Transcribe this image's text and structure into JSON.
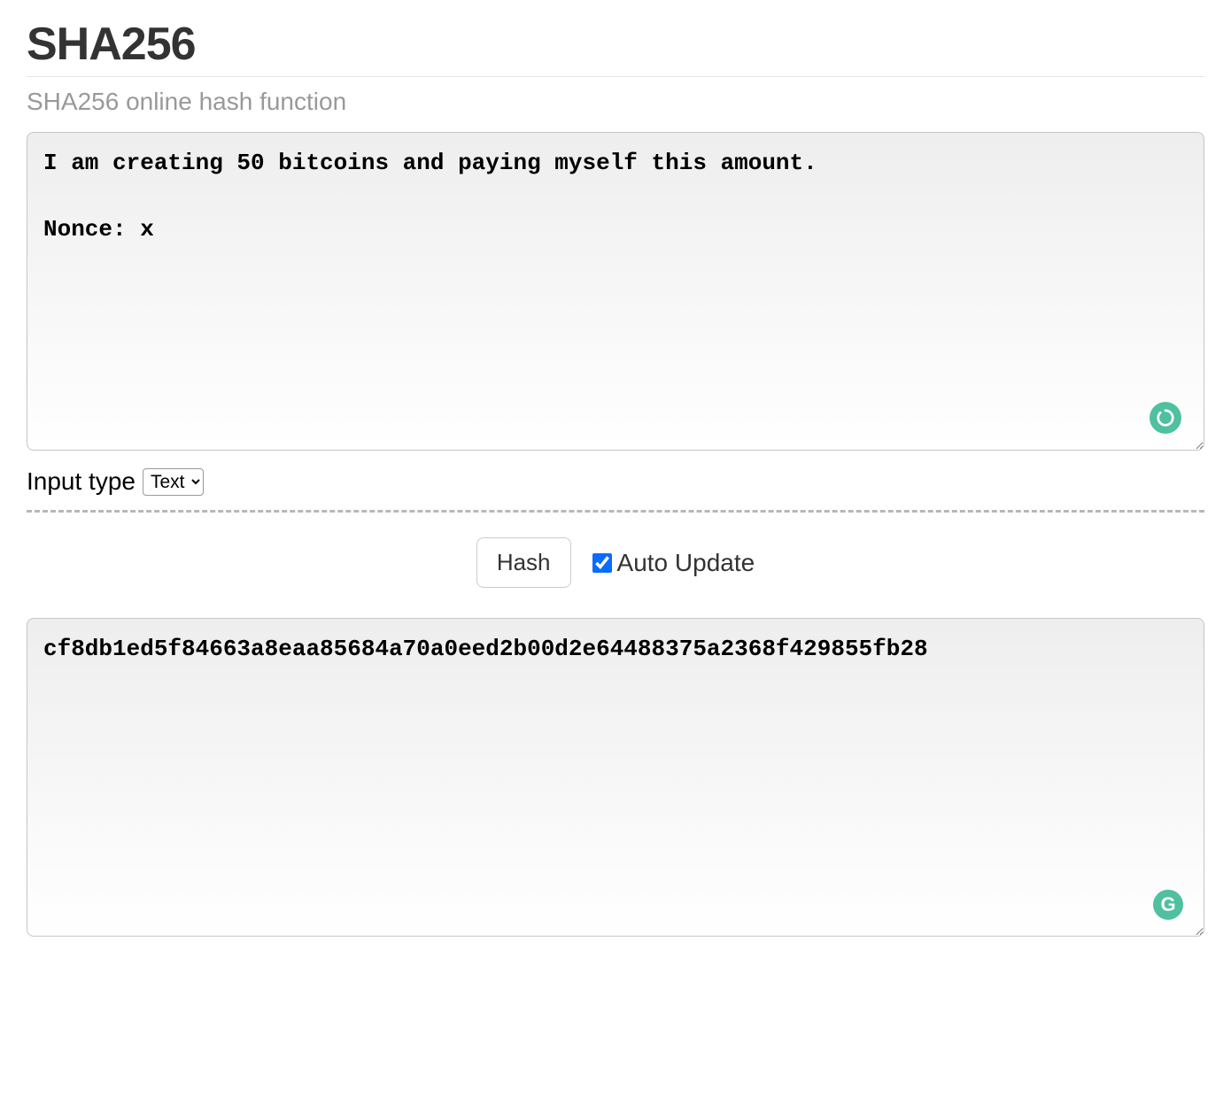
{
  "header": {
    "title": "SHA256",
    "subtitle": "SHA256 online hash function"
  },
  "input": {
    "value": "I am creating 50 bitcoins and paying myself this amount.\n\nNonce: x"
  },
  "input_type": {
    "label": "Input type",
    "selected": "Text"
  },
  "controls": {
    "hash_button_label": "Hash",
    "auto_update_label": "Auto Update",
    "auto_update_checked": true
  },
  "output": {
    "value": "cf8db1ed5f84663a8eaa85684a70a0eed2b00d2e64488375a2368f429855fb28"
  },
  "badges": {
    "grammarly_letter": "G"
  }
}
